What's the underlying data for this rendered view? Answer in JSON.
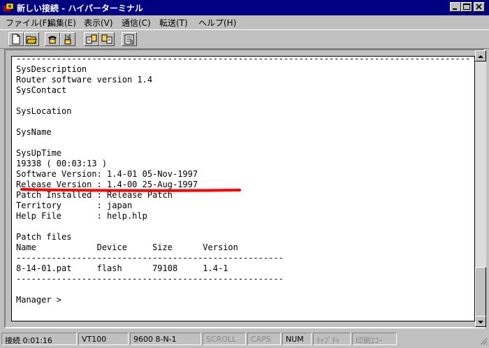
{
  "window": {
    "title": "新しい接続 - ハイパーターミナル"
  },
  "menu": [
    "ファイル(F)",
    "編集(E)",
    "表示(V)",
    "通信(C)",
    "転送(T)",
    "ヘルプ(H)"
  ],
  "toolbar": [
    "new-icon",
    "open-icon",
    "phone-icon",
    "disconnect-icon",
    "send-icon",
    "receive-icon",
    "properties-icon"
  ],
  "terminal": {
    "lines": [
      "------------------------------------------------------------------------------------------",
      "SysDescription",
      "Router software version 1.4",
      "SysContact",
      "",
      "SysLocation",
      "",
      "SysName",
      "",
      "SysUpTime",
      "19338 ( 00:03:13 )",
      "Software Version: 1.4-01 05-Nov-1997",
      "Release Version : 1.4-00 25-Aug-1997",
      "Patch Installed : Release Patch",
      "Territory       : japan",
      "Help File       : help.hlp",
      "",
      "Patch files",
      "Name            Device     Size      Version",
      "-----------------------------------------------------",
      "8-14-01.pat     flash      79108     1.4-1",
      "-----------------------------------------------------",
      "",
      "Manager >"
    ],
    "highlight_color": "#ff0000"
  },
  "status": {
    "elapsed": "接続 0:01:16",
    "emulation": "VT100",
    "settings": "9600 8-N-1",
    "scroll": "SCROLL",
    "caps": "CAPS",
    "num": "NUM",
    "capture": "ｷｬﾌﾟﾁｬ",
    "print_echo": "印刷ｴｺｰ"
  }
}
